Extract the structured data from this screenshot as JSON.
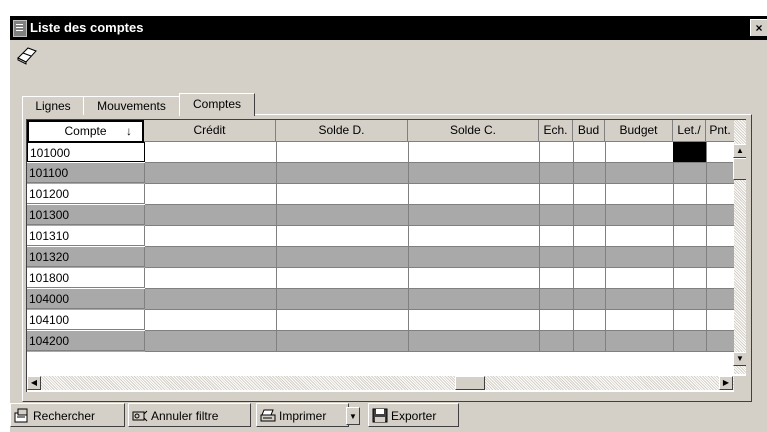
{
  "window": {
    "title": "Liste des comptes",
    "close_label": "×"
  },
  "tabs": [
    {
      "label": "Lignes",
      "active": false
    },
    {
      "label": "Mouvements",
      "active": false
    },
    {
      "label": "Comptes",
      "active": true
    }
  ],
  "grid": {
    "columns": [
      "Compte",
      "Crédit",
      "Solde D.",
      "Solde C.",
      "Ech.",
      "Bud",
      "Budget",
      "Let./",
      "Pnt."
    ],
    "sort_icon": "↓",
    "rows": [
      [
        "101000",
        "",
        "",
        "",
        "",
        "",
        "",
        "",
        ""
      ],
      [
        "101100",
        "",
        "",
        "",
        "",
        "",
        "",
        "",
        ""
      ],
      [
        "101200",
        "",
        "",
        "",
        "",
        "",
        "",
        "",
        ""
      ],
      [
        "101300",
        "",
        "",
        "",
        "",
        "",
        "",
        "",
        ""
      ],
      [
        "101310",
        "",
        "",
        "",
        "",
        "",
        "",
        "",
        ""
      ],
      [
        "101320",
        "",
        "",
        "",
        "",
        "",
        "",
        "",
        ""
      ],
      [
        "101800",
        "",
        "",
        "",
        "",
        "",
        "",
        "",
        ""
      ],
      [
        "104000",
        "",
        "",
        "",
        "",
        "",
        "",
        "",
        ""
      ],
      [
        "104100",
        "",
        "",
        "",
        "",
        "",
        "",
        "",
        ""
      ],
      [
        "104200",
        "",
        "",
        "",
        "",
        "",
        "",
        "",
        ""
      ]
    ]
  },
  "scrollbar_arrows": {
    "up": "▲",
    "down": "▼",
    "left": "◀",
    "right": "▶"
  },
  "toolbar": {
    "search_label": "Rechercher",
    "cancel_filter_label": "Annuler filtre",
    "print_label": "Imprimer",
    "print_dropdown": "▼",
    "export_label": "Exporter"
  },
  "icons": [
    "app-icon",
    "eraser-icon",
    "search-icon",
    "filter-icon",
    "printer-icon",
    "floppy-disk-icon"
  ],
  "colors": {
    "title_bar": "#000000",
    "window_bg": "#d4d0c8",
    "alt_row": "#a9a9a9"
  }
}
